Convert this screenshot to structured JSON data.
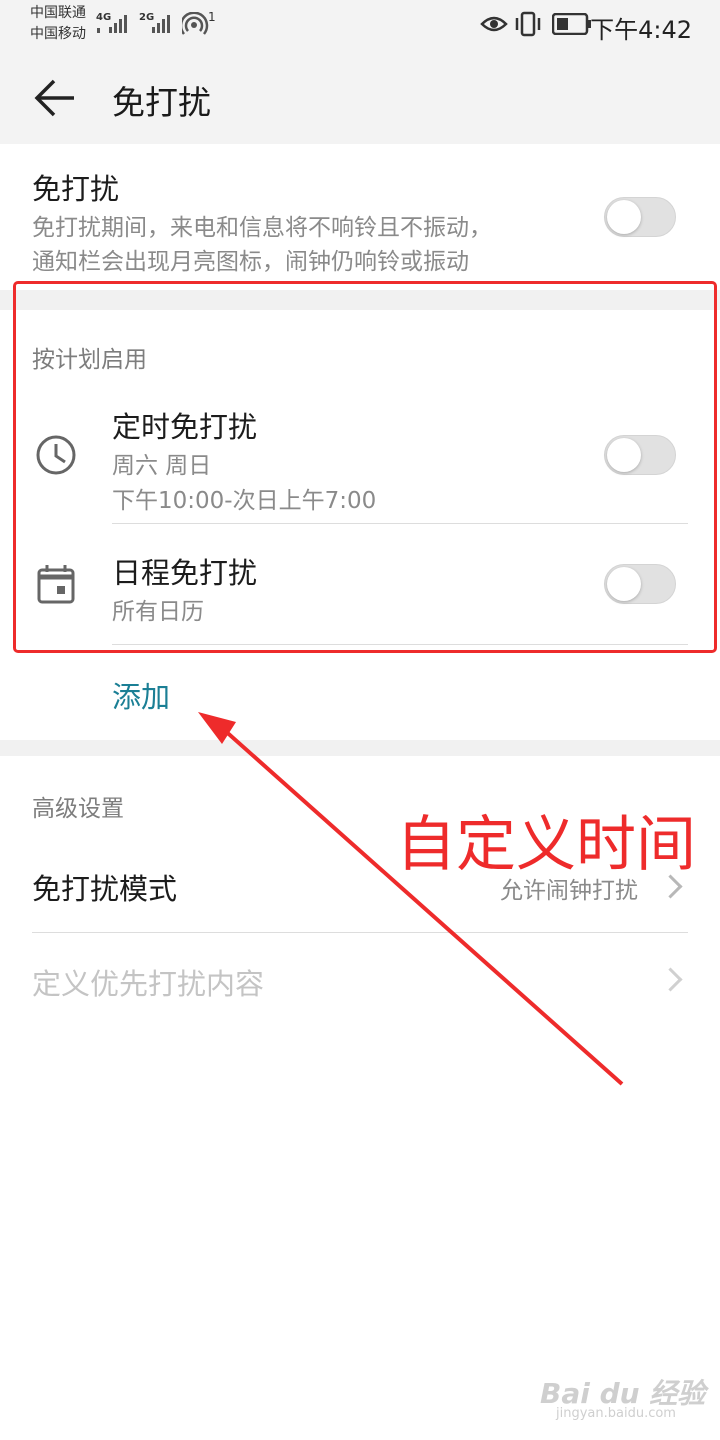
{
  "status_bar": {
    "carrier1": "中国联通",
    "carrier2": "中国移动",
    "net1": "4G",
    "net2": "2G",
    "hotspot_count": "1",
    "time": "下午4:42"
  },
  "header": {
    "title": "免打扰"
  },
  "main_toggle": {
    "title": "免打扰",
    "description_line1": "免打扰期间，来电和信息将不响铃且不振动，",
    "description_line2": "通知栏会出现月亮图标，闹钟仍响铃或振动",
    "enabled": false
  },
  "schedule_section": {
    "heading": "按计划启用",
    "items": [
      {
        "icon": "clock-icon",
        "title": "定时免打扰",
        "subtitle1": "周六 周日",
        "subtitle2": "下午10:00-次日上午7:00",
        "enabled": false
      },
      {
        "icon": "calendar-icon",
        "title": "日程免打扰",
        "subtitle1": "所有日历",
        "enabled": false
      }
    ],
    "add_label": "添加"
  },
  "annotation": {
    "text": "自定义时间",
    "color": "#ee2b2b"
  },
  "advanced_section": {
    "heading": "高级设置",
    "items": [
      {
        "title": "免打扰模式",
        "value": "允许闹钟打扰",
        "enabled": true
      },
      {
        "title": "定义优先打扰内容",
        "enabled": false
      }
    ]
  },
  "watermark": {
    "logo": "Bai du 经验",
    "url": "jingyan.baidu.com"
  },
  "colors": {
    "accent": "#1b7f95",
    "annotation_red": "#ee2b2b",
    "toggle_off": "#e1e1e1"
  }
}
